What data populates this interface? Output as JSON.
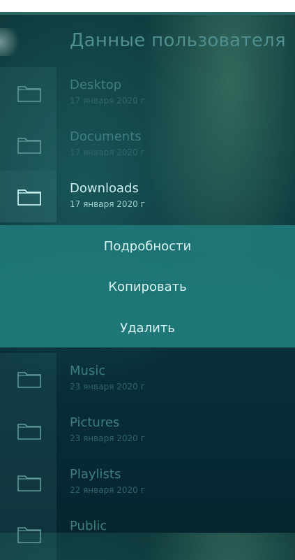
{
  "page": {
    "title": "Данные пользователя"
  },
  "entries_top": [
    {
      "name": "Desktop",
      "date": "17 января 2020 г"
    },
    {
      "name": "Documents",
      "date": "17 января 2020 г"
    },
    {
      "name": "Downloads",
      "date": "17 января 2020 г"
    }
  ],
  "context_menu": {
    "items": [
      "Подробности",
      "Копировать",
      "Удалить"
    ]
  },
  "entries_bottom": [
    {
      "name": "Music",
      "date": "23 января 2020 г"
    },
    {
      "name": "Pictures",
      "date": "23 января 2020 г"
    },
    {
      "name": "Playlists",
      "date": "22 января 2020 г"
    },
    {
      "name": "Public",
      "date": ""
    }
  ],
  "icons": {
    "folder": "folder-icon"
  },
  "colors": {
    "accent": "#1f7676",
    "background": "#0c3a3e"
  }
}
